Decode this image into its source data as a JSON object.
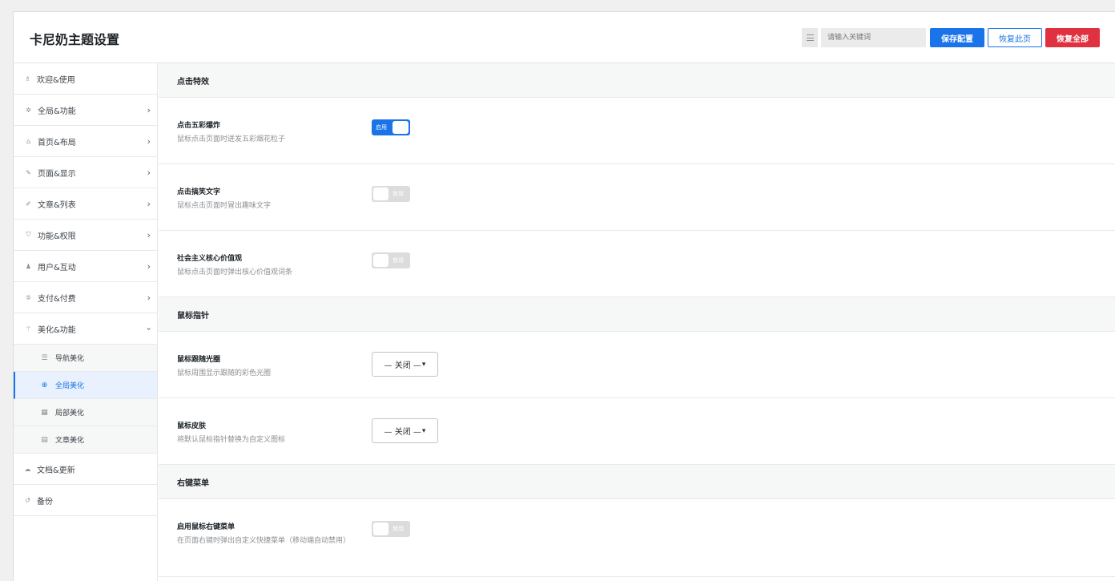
{
  "header": {
    "title": "卡尼奶主题设置",
    "search_placeholder": "请输入关键词",
    "save_label": "保存配置",
    "restore_page_label": "恢复此页",
    "restore_all_label": "恢复全部"
  },
  "sidebar": {
    "items": [
      {
        "label": "欢迎&使用",
        "icon": "award-icon"
      },
      {
        "label": "全局&功能",
        "icon": "gear-icon"
      },
      {
        "label": "首页&布局",
        "icon": "home-icon"
      },
      {
        "label": "页面&显示",
        "icon": "pin-icon"
      },
      {
        "label": "文章&列表",
        "icon": "thumbtack-icon"
      },
      {
        "label": "功能&权限",
        "icon": "shield-icon"
      },
      {
        "label": "用户&互动",
        "icon": "user-icon"
      },
      {
        "label": "支付&付费",
        "icon": "dollar-icon"
      },
      {
        "label": "美化&功能",
        "icon": "magic-wand-icon"
      }
    ],
    "sub_items": [
      {
        "label": "导航美化",
        "icon": "menu-icon"
      },
      {
        "label": "全局美化",
        "icon": "globe-icon"
      },
      {
        "label": "局部美化",
        "icon": "grid-icon"
      },
      {
        "label": "文章美化",
        "icon": "file-icon"
      }
    ],
    "bottom_items": [
      {
        "label": "文档&更新",
        "icon": "cloud-icon"
      },
      {
        "label": "备份",
        "icon": "history-icon"
      }
    ]
  },
  "sections": {
    "click": {
      "title": "点击特效",
      "rows": [
        {
          "label": "点击五彩爆炸",
          "desc": "鼠标点击页面时迸发五彩烟花粒子",
          "state": "启用"
        },
        {
          "label": "点击搞笑文字",
          "desc": "鼠标点击页面时冒出趣味文字",
          "state": "禁用"
        },
        {
          "label": "社会主义核心价值观",
          "desc": "鼠标点击页面时弹出核心价值观词条",
          "state": "禁用"
        }
      ]
    },
    "cursor": {
      "title": "鼠标指针",
      "rows": [
        {
          "label": "鼠标跟随光圈",
          "desc": "鼠标周围显示跟随的彩色光圈",
          "value": "— 关闭 —"
        },
        {
          "label": "鼠标皮肤",
          "desc": "将默认鼠标指针替换为自定义图标",
          "value": "— 关闭 —"
        }
      ]
    },
    "context_menu": {
      "title": "右键菜单",
      "rows": [
        {
          "label": "启用鼠标右键菜单",
          "desc": "在页面右键时弹出自定义快捷菜单（移动端自动禁用）",
          "state": "禁用"
        }
      ]
    }
  },
  "colors": {
    "accent": "#1a73e8",
    "danger": "#e03140"
  }
}
